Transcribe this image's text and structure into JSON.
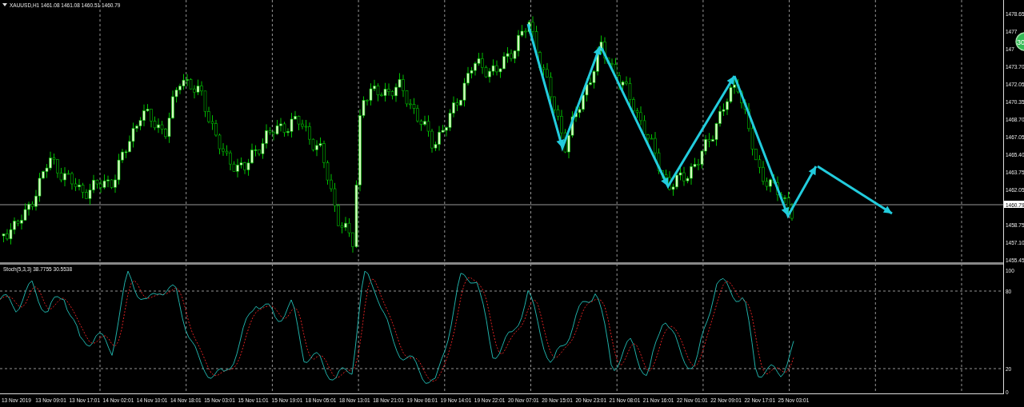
{
  "chart": {
    "title": "XAUUSD,H1 1461.08 1461.08 1460.51 1460.79",
    "price_ticks": [
      "1478.65",
      "1477",
      "147",
      "1473.70",
      "1472.05",
      "1470.35",
      "1468.70",
      "1467.05",
      "1465.40",
      "1463.75",
      "1462.05",
      "1458.75",
      "1457.10",
      "1455.45"
    ],
    "current_price": "1460.79",
    "badge": "30"
  },
  "indicator": {
    "label": "Stoch(5,3,3) 38.7755 30.5538",
    "ticks": [
      "100",
      "80",
      "20",
      "0"
    ]
  },
  "time_axis": [
    "13 Nov 2019",
    "13 Nov 09:01",
    "13 Nov 17:01",
    "14 Nov 02:01",
    "14 Nov 10:01",
    "14 Nov 18:01",
    "15 Nov 03:01",
    "15 Nov 11:01",
    "15 Nov 19:01",
    "18 Nov 05:01",
    "18 Nov 13:01",
    "18 Nov 21:01",
    "19 Nov 06:01",
    "19 Nov 14:01",
    "19 Nov 22:01",
    "20 Nov 07:01",
    "20 Nov 15:01",
    "20 Nov 23:01",
    "21 Nov 08:01",
    "21 Nov 16:01",
    "22 Nov 01:01",
    "22 Nov 09:01",
    "22 Nov 17:01",
    "25 Nov 03:01"
  ]
}
